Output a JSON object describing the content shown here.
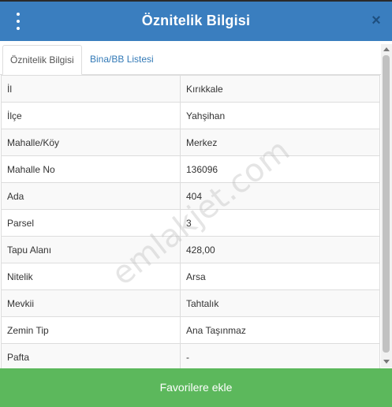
{
  "header": {
    "title": "Öznitelik Bilgisi",
    "close_glyph": "×",
    "menu_icon": "vertical-ellipsis",
    "close_icon": "close-x",
    "background": "#3a7ebf"
  },
  "tabs": [
    {
      "label": "Öznitelik Bilgisi",
      "active": true
    },
    {
      "label": "Bina/BB Listesi",
      "active": false
    }
  ],
  "attributes": [
    {
      "key": "İl",
      "value": "Kırıkkale"
    },
    {
      "key": "İlçe",
      "value": "Yahşihan"
    },
    {
      "key": "Mahalle/Köy",
      "value": "Merkez"
    },
    {
      "key": "Mahalle No",
      "value": "136096"
    },
    {
      "key": "Ada",
      "value": "404"
    },
    {
      "key": "Parsel",
      "value": "3"
    },
    {
      "key": "Tapu Alanı",
      "value": "428,00"
    },
    {
      "key": "Nitelik",
      "value": "Arsa"
    },
    {
      "key": "Mevkii",
      "value": "Tahtalık"
    },
    {
      "key": "Zemin Tip",
      "value": "Ana Taşınmaz"
    },
    {
      "key": "Pafta",
      "value": "-"
    }
  ],
  "watermark": "emlakjet.com",
  "footer": {
    "button_label": "Favorilere ekle",
    "color": "#5cb85c"
  }
}
